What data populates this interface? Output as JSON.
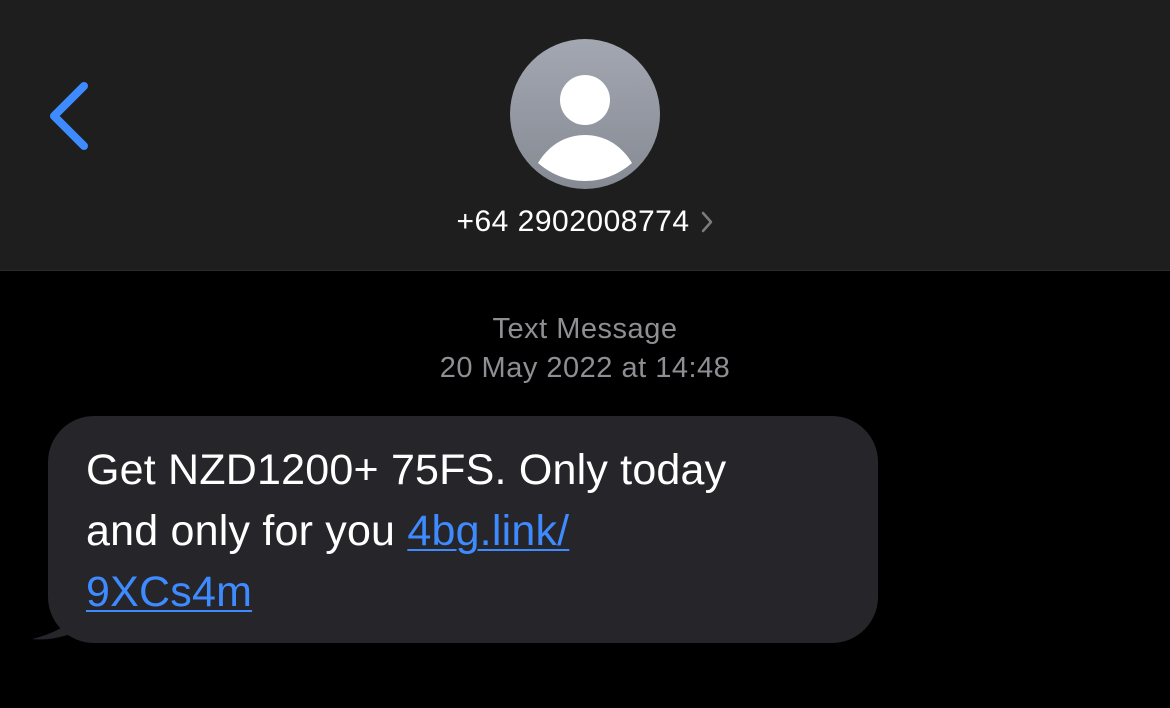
{
  "header": {
    "back_icon": "chevron-left-icon",
    "avatar_icon": "person-silhouette-icon",
    "contact_number": "+64 2902008774",
    "contact_chevron_icon": "chevron-right-icon"
  },
  "conversation": {
    "service_label": "Text Message",
    "timestamp_date": "20 May 2022",
    "timestamp_at": "at",
    "timestamp_time": "14:48",
    "message": {
      "line1": "Get NZD1200+ 75FS. Only today",
      "line2_text": "and only for you",
      "link_part1": "4bg.link/",
      "link_part2": "9XCs4m"
    }
  },
  "colors": {
    "header_bg": "#1e1e1e",
    "screen_bg": "#000000",
    "accent_blue": "#3e8bff",
    "bubble_bg": "#26252a",
    "meta_gray": "#8e8e93"
  }
}
